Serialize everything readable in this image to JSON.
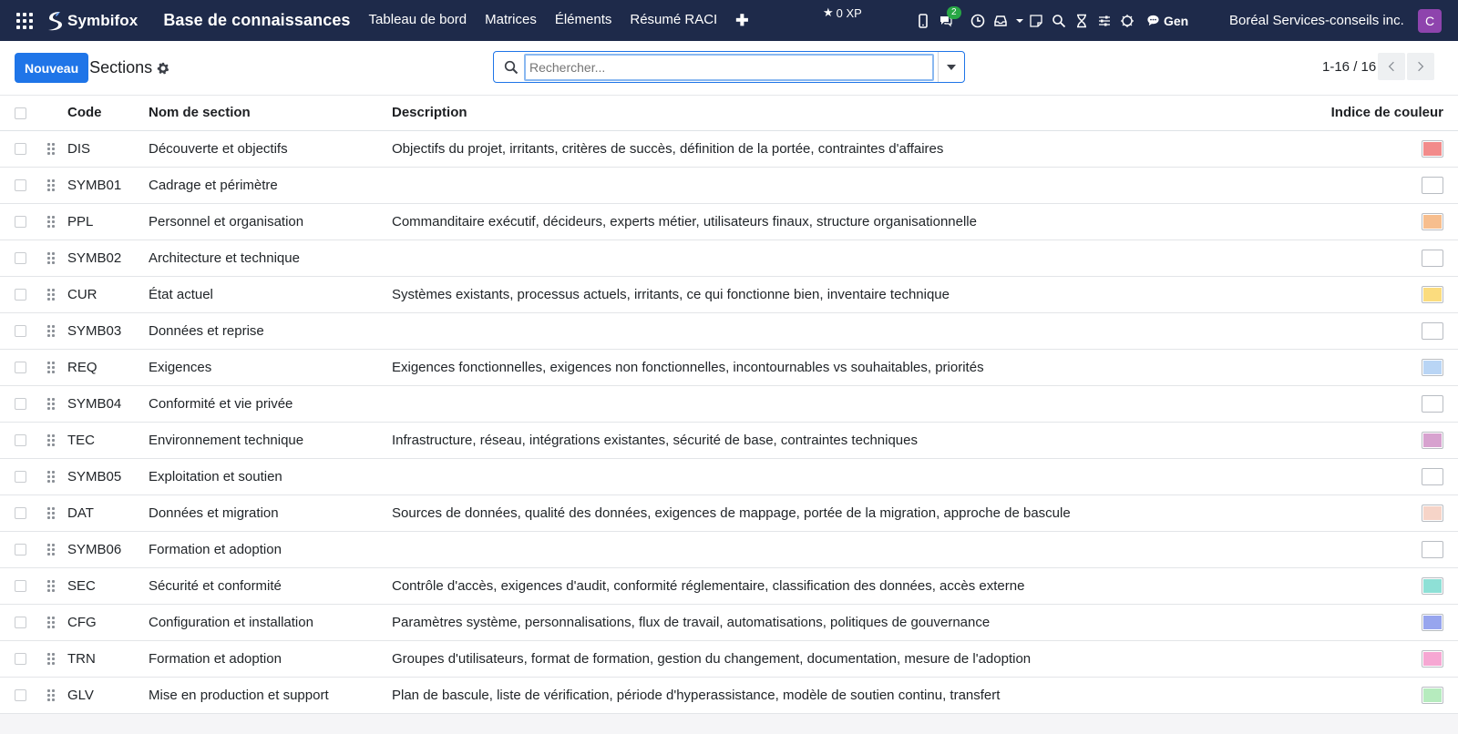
{
  "navbar": {
    "brand": "Symbifox",
    "app_title": "Base de connaissances",
    "menu": [
      "Tableau de bord",
      "Matrices",
      "Éléments",
      "Résumé RACI"
    ],
    "xp": "0 XP",
    "messages_badge": "2",
    "gen_label": "Gen",
    "company": "Boréal Services-conseils inc.",
    "avatar_initial": "C"
  },
  "control_panel": {
    "new_button": "Nouveau",
    "breadcrumb": "Sections",
    "search_placeholder": "Rechercher...",
    "pager_value": "1-16 / 16"
  },
  "table": {
    "headers": {
      "code": "Code",
      "name": "Nom de section",
      "description": "Description",
      "color": "Indice de couleur"
    },
    "rows": [
      {
        "code": "DIS",
        "name": "Découverte et objectifs",
        "description": "Objectifs du projet, irritants, critères de succès, définition de la portée, contraintes d'affaires",
        "color": "#f28b8b"
      },
      {
        "code": "SYMB01",
        "name": "Cadrage et périmètre",
        "description": "",
        "color": "#ffffff"
      },
      {
        "code": "PPL",
        "name": "Personnel et organisation",
        "description": "Commanditaire exécutif, décideurs, experts métier, utilisateurs finaux, structure organisationnelle",
        "color": "#f7be8e"
      },
      {
        "code": "SYMB02",
        "name": "Architecture et technique",
        "description": "",
        "color": "#ffffff"
      },
      {
        "code": "CUR",
        "name": "État actuel",
        "description": "Systèmes existants, processus actuels, irritants, ce qui fonctionne bien, inventaire technique",
        "color": "#fbdc7e"
      },
      {
        "code": "SYMB03",
        "name": "Données et reprise",
        "description": "",
        "color": "#ffffff"
      },
      {
        "code": "REQ",
        "name": "Exigences",
        "description": "Exigences fonctionnelles, exigences non fonctionnelles, incontournables vs souhaitables, priorités",
        "color": "#b9d5f5"
      },
      {
        "code": "SYMB04",
        "name": "Conformité et vie privée",
        "description": "",
        "color": "#ffffff"
      },
      {
        "code": "TEC",
        "name": "Environnement technique",
        "description": "Infrastructure, réseau, intégrations existantes, sécurité de base, contraintes techniques",
        "color": "#d7a2cf"
      },
      {
        "code": "SYMB05",
        "name": "Exploitation et soutien",
        "description": "",
        "color": "#ffffff"
      },
      {
        "code": "DAT",
        "name": "Données et migration",
        "description": "Sources de données, qualité des données, exigences de mappage, portée de la migration, approche de bascule",
        "color": "#f6d4c8"
      },
      {
        "code": "SYMB06",
        "name": "Formation et adoption",
        "description": "",
        "color": "#ffffff"
      },
      {
        "code": "SEC",
        "name": "Sécurité et conformité",
        "description": "Contrôle d'accès, exigences d'audit, conformité réglementaire, classification des données, accès externe",
        "color": "#8ee0d6"
      },
      {
        "code": "CFG",
        "name": "Configuration et installation",
        "description": "Paramètres système, personnalisations, flux de travail, automatisations, politiques de gouvernance",
        "color": "#97a5ee"
      },
      {
        "code": "TRN",
        "name": "Formation et adoption",
        "description": "Groupes d'utilisateurs, format de formation, gestion du changement, documentation, mesure de l'adoption",
        "color": "#f6a7d3"
      },
      {
        "code": "GLV",
        "name": "Mise en production et support",
        "description": "Plan de bascule, liste de vérification, période d'hyperassistance, modèle de soutien continu, transfert",
        "color": "#b6ebbe"
      }
    ]
  },
  "colors": {
    "navbar_bg": "#1e2a4a",
    "primary": "#1f75e8"
  }
}
